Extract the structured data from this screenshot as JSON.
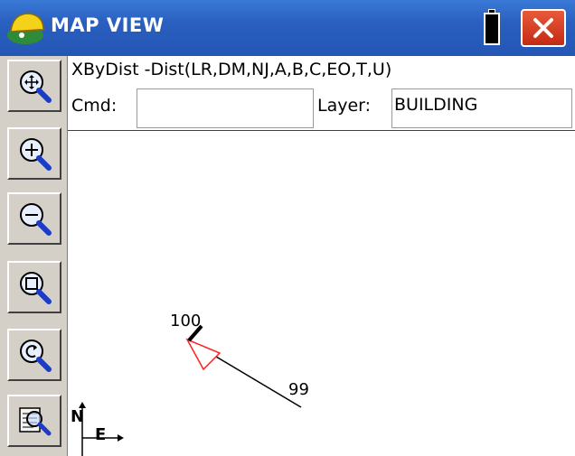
{
  "window": {
    "title": "MAP VIEW"
  },
  "toolbar": {
    "items": [
      {
        "icon": "zoom-extents-icon"
      },
      {
        "icon": "zoom-in-icon"
      },
      {
        "icon": "zoom-out-icon"
      },
      {
        "icon": "zoom-window-icon"
      },
      {
        "icon": "zoom-previous-icon"
      },
      {
        "icon": "map-options-icon"
      }
    ]
  },
  "command": {
    "prompt": "XByDist -Dist(LR,DM,NJ,A,B,C,EO,T,U)",
    "cmd_label": "Cmd:",
    "cmd_value": "",
    "layer_label": "Layer:",
    "layer_value": "BUILDING"
  },
  "map": {
    "points": [
      {
        "label": "100"
      },
      {
        "label": "99"
      }
    ],
    "north_label": "N",
    "east_label": "E"
  },
  "colors": {
    "titlebar": "#2a5fc0",
    "arrow": "#ff0000",
    "close": "#d03a1e"
  }
}
